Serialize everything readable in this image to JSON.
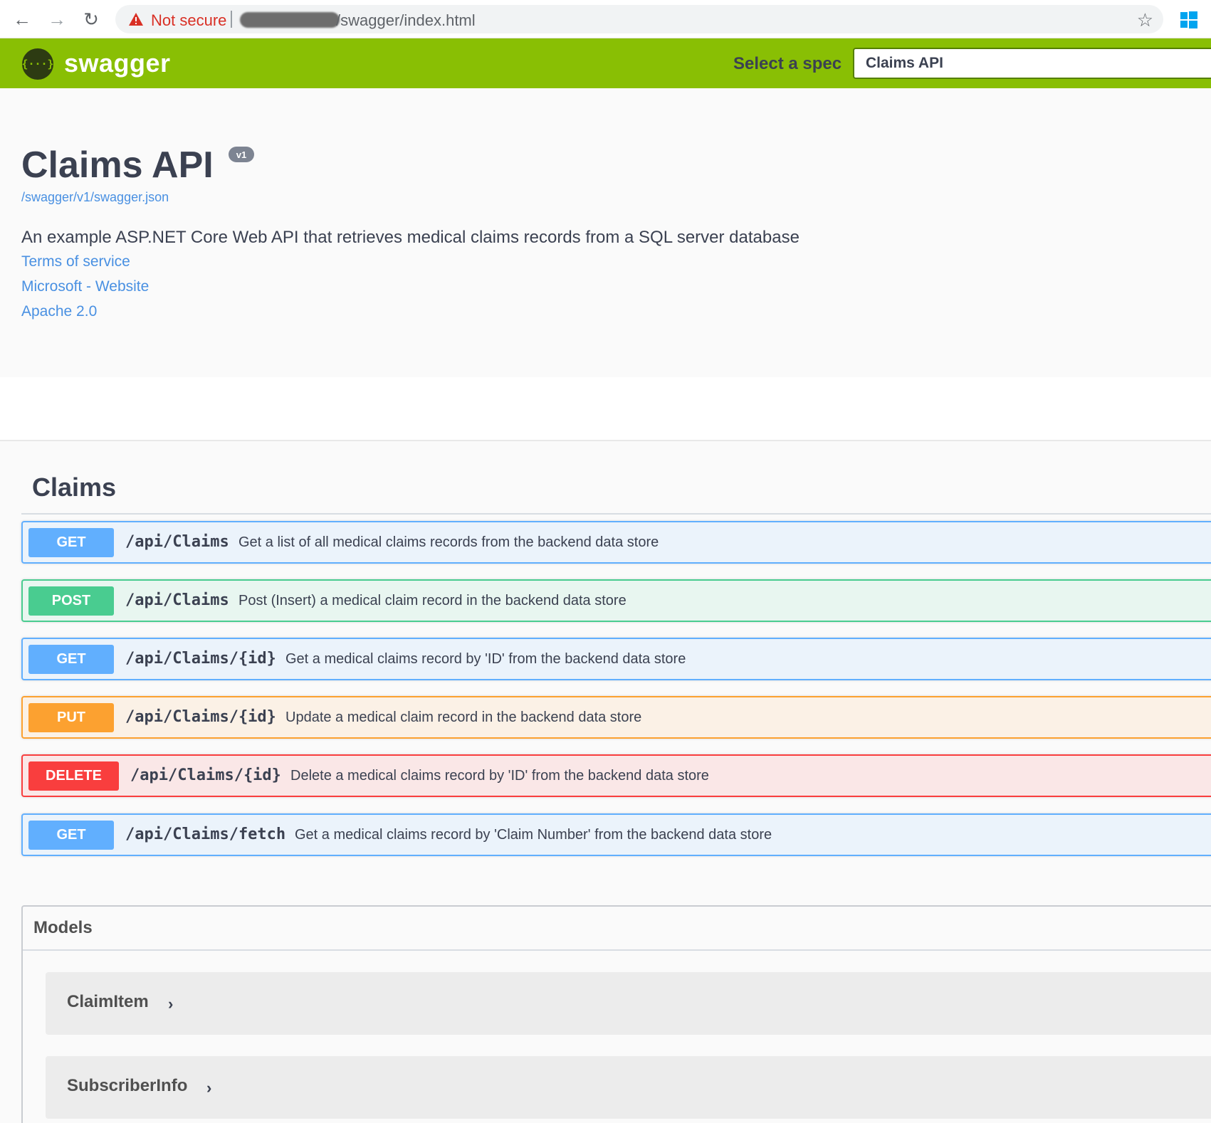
{
  "browser": {
    "security_label": "Not secure",
    "url_path": "/swagger/index.html",
    "back_glyph": "←",
    "forward_glyph": "→",
    "reload_glyph": "↻",
    "star_glyph": "☆",
    "icons": [
      "back-arrow-icon",
      "forward-arrow-icon",
      "reload-icon",
      "warning-icon",
      "bookmark-star-icon",
      "windows-icon"
    ]
  },
  "topbar": {
    "logo_glyph": "{···}",
    "logo_text": "swagger",
    "spec_label": "Select a spec",
    "spec_value": "Claims API",
    "bar_color": "#89bf04"
  },
  "info": {
    "title": "Claims API",
    "version": "v1",
    "json_link": "/swagger/v1/swagger.json",
    "description": "An example ASP.NET Core Web API that retrieves medical claims records from a SQL server database",
    "links": [
      "Terms of service",
      "Microsoft - Website",
      "Apache 2.0"
    ]
  },
  "tag": {
    "name": "Claims"
  },
  "operations": [
    {
      "method": "GET",
      "path": "/api/Claims",
      "summary": "Get a list of all medical claims records from the backend data store"
    },
    {
      "method": "POST",
      "path": "/api/Claims",
      "summary": "Post (Insert) a medical claim record in the backend data store"
    },
    {
      "method": "GET",
      "path": "/api/Claims/{id}",
      "summary": "Get a medical claims record by 'ID' from the backend data store"
    },
    {
      "method": "PUT",
      "path": "/api/Claims/{id}",
      "summary": "Update a medical claim record in the backend data store"
    },
    {
      "method": "DELETE",
      "path": "/api/Claims/{id}",
      "summary": "Delete a medical claims record by 'ID' from the backend data store"
    },
    {
      "method": "GET",
      "path": "/api/Claims/fetch",
      "summary": "Get a medical claims record by 'Claim Number' from the backend data store"
    }
  ],
  "method_colors": {
    "GET": "#61affe",
    "POST": "#49cc90",
    "PUT": "#fca130",
    "DELETE": "#f93e3e"
  },
  "models": {
    "title": "Models",
    "chevron_glyph": "›",
    "items": [
      "ClaimItem",
      "SubscriberInfo"
    ]
  }
}
